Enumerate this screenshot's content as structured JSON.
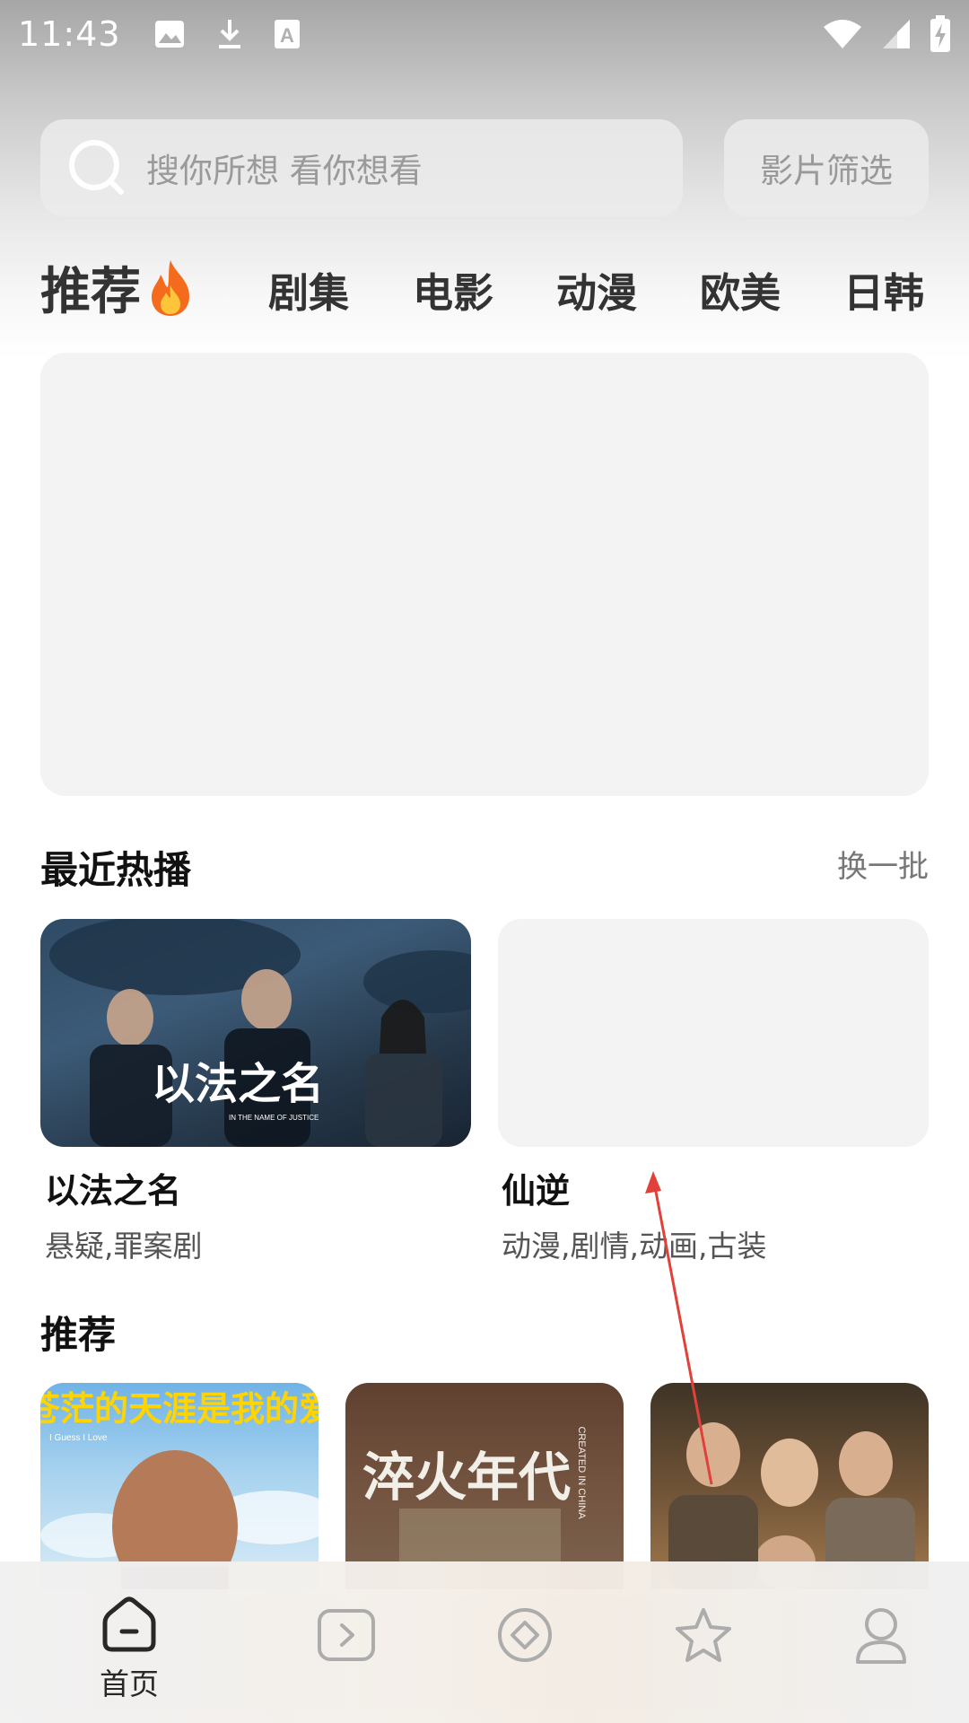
{
  "status_bar": {
    "time": "11:43",
    "icons": [
      "image-icon",
      "download-icon",
      "a-icon",
      "wifi-icon",
      "signal-icon",
      "battery-charging-icon"
    ]
  },
  "search": {
    "placeholder": "搜你所想 看你想看",
    "filter_label": "影片筛选"
  },
  "tabs": [
    {
      "label": "推荐",
      "active": true,
      "icon": "fire-icon"
    },
    {
      "label": "剧集"
    },
    {
      "label": "电影"
    },
    {
      "label": "动漫"
    },
    {
      "label": "欧美"
    },
    {
      "label": "日韩"
    }
  ],
  "recent": {
    "title": "最近热播",
    "refresh_label": "换一批",
    "items": [
      {
        "title": "以法之名",
        "tags": "悬疑,罪案剧",
        "poster_text": "以法之名",
        "poster_subtext": "IN THE NAME OF JUSTICE"
      },
      {
        "title": "仙逆",
        "tags": "动漫,剧情,动画,古装"
      }
    ]
  },
  "recommend": {
    "title": "推荐",
    "items": [
      {
        "poster_text": "苍茫的天涯是我的爱",
        "poster_subtext": "I Guess I Love"
      },
      {
        "poster_text": "淬火年代",
        "poster_subtext": "CREATED IN CHINA"
      },
      {
        "poster_text": ""
      }
    ]
  },
  "bottom_nav": [
    {
      "label": "首页",
      "icon": "home-icon",
      "active": true
    },
    {
      "label": "",
      "icon": "play-icon"
    },
    {
      "label": "",
      "icon": "compass-icon"
    },
    {
      "label": "",
      "icon": "star-icon"
    },
    {
      "label": "",
      "icon": "user-icon"
    }
  ],
  "colors": {
    "accent_arrow": "#e0413a",
    "banner_placeholder": "#f3f3f3"
  }
}
